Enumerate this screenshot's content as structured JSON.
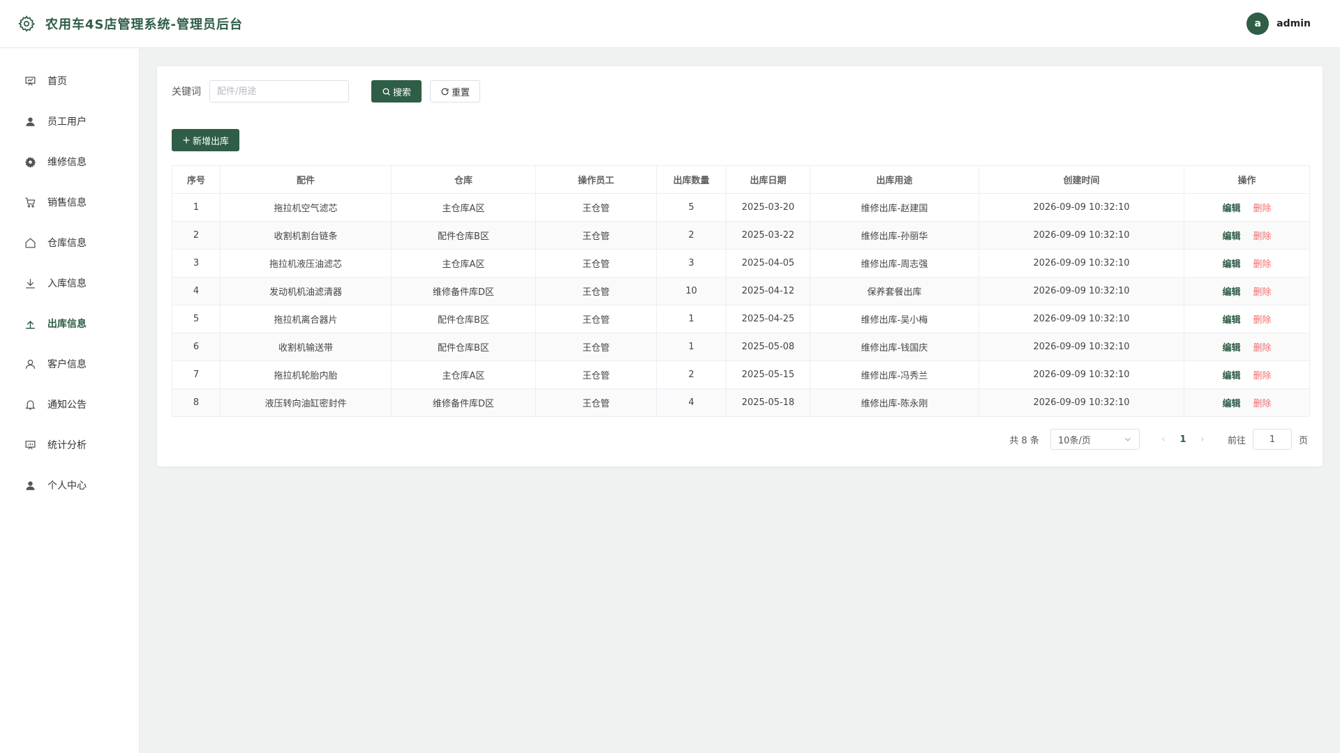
{
  "app": {
    "title": "农用车4S店管理系统-管理员后台"
  },
  "user": {
    "avatar_letter": "a",
    "name": "admin"
  },
  "sidebar": {
    "items": [
      {
        "label": "首页",
        "icon": "presentation-icon",
        "active": false
      },
      {
        "label": "员工用户",
        "icon": "user-icon",
        "active": false
      },
      {
        "label": "维修信息",
        "icon": "gear-icon",
        "active": false
      },
      {
        "label": "销售信息",
        "icon": "cart-icon",
        "active": false
      },
      {
        "label": "仓库信息",
        "icon": "home-icon",
        "active": false
      },
      {
        "label": "入库信息",
        "icon": "download-icon",
        "active": false
      },
      {
        "label": "出库信息",
        "icon": "upload-icon",
        "active": true
      },
      {
        "label": "客户信息",
        "icon": "user-outline-icon",
        "active": false
      },
      {
        "label": "通知公告",
        "icon": "bell-icon",
        "active": false
      },
      {
        "label": "统计分析",
        "icon": "chart-board-icon",
        "active": false
      },
      {
        "label": "个人中心",
        "icon": "user-icon",
        "active": false
      }
    ]
  },
  "search": {
    "label": "关键词",
    "value": "",
    "placeholder": "配件/用途",
    "search_label": "搜索",
    "reset_label": "重置"
  },
  "toolbar": {
    "add_label": "新增出库"
  },
  "table": {
    "columns": [
      "序号",
      "配件",
      "仓库",
      "操作员工",
      "出库数量",
      "出库日期",
      "出库用途",
      "创建时间",
      "操作"
    ],
    "rows": [
      [
        "1",
        "拖拉机空气滤芯",
        "主仓库A区",
        "王仓管",
        "5",
        "2025-03-20",
        "维修出库-赵建国",
        "2026-09-09 10:32:10"
      ],
      [
        "2",
        "收割机割台链条",
        "配件仓库B区",
        "王仓管",
        "2",
        "2025-03-22",
        "维修出库-孙丽华",
        "2026-09-09 10:32:10"
      ],
      [
        "3",
        "拖拉机液压油滤芯",
        "主仓库A区",
        "王仓管",
        "3",
        "2025-04-05",
        "维修出库-周志强",
        "2026-09-09 10:32:10"
      ],
      [
        "4",
        "发动机机油滤清器",
        "维修备件库D区",
        "王仓管",
        "10",
        "2025-04-12",
        "保养套餐出库",
        "2026-09-09 10:32:10"
      ],
      [
        "5",
        "拖拉机离合器片",
        "配件仓库B区",
        "王仓管",
        "1",
        "2025-04-25",
        "维修出库-吴小梅",
        "2026-09-09 10:32:10"
      ],
      [
        "6",
        "收割机输送带",
        "配件仓库B区",
        "王仓管",
        "1",
        "2025-05-08",
        "维修出库-钱国庆",
        "2026-09-09 10:32:10"
      ],
      [
        "7",
        "拖拉机轮胎内胎",
        "主仓库A区",
        "王仓管",
        "2",
        "2025-05-15",
        "维修出库-冯秀兰",
        "2026-09-09 10:32:10"
      ],
      [
        "8",
        "液压转向油缸密封件",
        "维修备件库D区",
        "王仓管",
        "4",
        "2025-05-18",
        "维修出库-陈永刚",
        "2026-09-09 10:32:10"
      ]
    ],
    "edit_label": "编辑",
    "delete_label": "删除"
  },
  "pagination": {
    "total_text": "共 8 条",
    "page_size": "10条/页",
    "current_page": "1",
    "goto_label": "前往",
    "goto_value": "1",
    "page_suffix": "页"
  },
  "colors": {
    "primary": "#2f5d46",
    "danger": "#f56c6c"
  }
}
